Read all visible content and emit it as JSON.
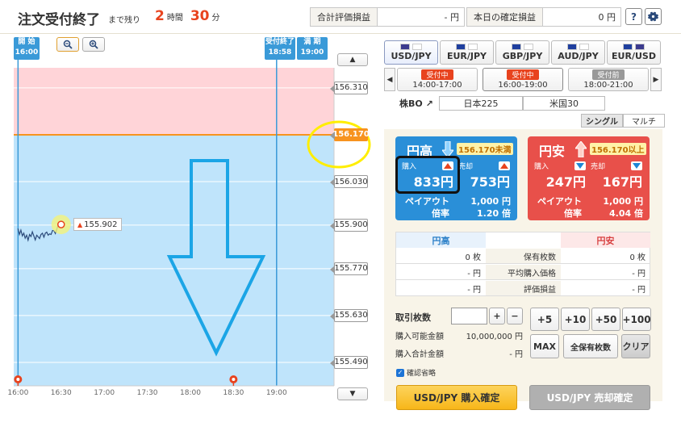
{
  "header": {
    "title": "注文受付終了",
    "remaining_label": "まで残り",
    "hours": "2",
    "hours_unit": "時間",
    "minutes": "30",
    "minutes_unit": "分",
    "total_pl_label": "合計評価損益",
    "total_pl_value": "- 円",
    "today_pl_label": "本日の確定損益",
    "today_pl_value": "0 円",
    "help_label": "?",
    "settings_icon": "gear-icon"
  },
  "chart": {
    "zoom_out_icon": "zoom-out-icon",
    "zoom_in_icon": "zoom-in-icon",
    "start": {
      "label": "開 始",
      "time": "16:00"
    },
    "cutoff": {
      "label": "受付終了",
      "time": "18:58"
    },
    "expiry": {
      "label": "満 期",
      "time": "19:00"
    },
    "price_labels": [
      "156.310",
      "156.170",
      "156.030",
      "155.900",
      "155.770",
      "155.630",
      "155.490"
    ],
    "current_price": "155.902",
    "strike": "156.170",
    "time_labels": [
      "16:00",
      "16:30",
      "17:00",
      "17:30",
      "18:00",
      "18:30",
      "19:00"
    ],
    "colors": {
      "above": "#ffd4d8",
      "below": "#bfe4fb",
      "strike_line": "#f7931e",
      "marker_line": "#3a9ad8",
      "highlight_circle": "#ffee00",
      "big_arrow": "#1ba5e6"
    }
  },
  "chart_data": {
    "type": "line",
    "x": [
      "16:00",
      "16:01",
      "16:02",
      "16:03",
      "16:04",
      "16:05",
      "16:06",
      "16:07",
      "16:08",
      "16:09",
      "16:10",
      "16:11",
      "16:12",
      "16:13",
      "16:14",
      "16:15",
      "16:16",
      "16:17",
      "16:18",
      "16:19",
      "16:20",
      "16:21",
      "16:22",
      "16:23",
      "16:24",
      "16:25",
      "16:26",
      "16:27",
      "16:28",
      "16:29",
      "16:30"
    ],
    "series": [
      {
        "values": [
          155.89,
          155.872,
          155.885,
          155.868,
          155.876,
          155.861,
          155.87,
          155.855,
          155.872,
          155.866,
          155.88,
          155.868,
          155.856,
          155.87,
          155.865,
          155.86,
          155.872,
          155.876,
          155.864,
          155.876,
          155.879,
          155.87,
          155.874,
          155.872,
          155.884,
          155.884,
          155.875,
          155.888,
          155.9,
          155.905,
          155.902
        ]
      }
    ],
    "ylim": [
      155.42,
      156.37
    ],
    "xlim": [
      "15:57",
      "19:40"
    ],
    "yticks": [
      "156.310",
      "156.170",
      "156.030",
      "155.900",
      "155.770",
      "155.630",
      "155.490"
    ],
    "xticks": [
      "16:00",
      "16:30",
      "17:00",
      "17:30",
      "18:00",
      "18:30",
      "19:00"
    ],
    "strike": 156.17,
    "grid": true
  },
  "currencies": [
    {
      "label": "USD/JPY",
      "active": true
    },
    {
      "label": "EUR/JPY",
      "active": false
    },
    {
      "label": "GBP/JPY",
      "active": false
    },
    {
      "label": "AUD/JPY",
      "active": false
    },
    {
      "label": "EUR/USD",
      "active": false
    }
  ],
  "sessions": [
    {
      "status": "受付中",
      "time": "14:00-17:00",
      "color": "#e8431e"
    },
    {
      "status": "受付中",
      "time": "16:00-19:00",
      "color": "#e8431e"
    },
    {
      "status": "受付前",
      "time": "18:00-21:00",
      "color": "#999999"
    }
  ],
  "index": {
    "label": "株BO",
    "items": [
      "日本225",
      "米国30"
    ]
  },
  "mode": {
    "single": "シングル",
    "multi": "マルチ"
  },
  "high": {
    "title": "円高",
    "condition": "156.170未満",
    "buy_label": "購入",
    "buy_price": "833円",
    "sell_label": "売却",
    "sell_price": "753円",
    "payout_label": "ペイアウト",
    "payout": "1,000 円",
    "odds_label": "倍率",
    "odds": "1.20 倍",
    "color": "#2a8fd8"
  },
  "low": {
    "title": "円安",
    "condition": "156.170以上",
    "buy_label": "購入",
    "buy_price": "247円",
    "sell_label": "売却",
    "sell_price": "167円",
    "payout_label": "ペイアウト",
    "payout": "1,000 円",
    "odds_label": "倍率",
    "odds": "4.04 倍",
    "color": "#e8504a"
  },
  "holdings": {
    "col_high": "円高",
    "col_low": "円安",
    "rows": [
      {
        "label": "保有枚数",
        "high": "0 枚",
        "low": "0 枚"
      },
      {
        "label": "平均購入価格",
        "high": "- 円",
        "low": "- 円"
      },
      {
        "label": "評価損益",
        "high": "- 円",
        "low": "- 円"
      }
    ]
  },
  "order": {
    "qty_label": "取引枚数",
    "qty_value": "",
    "plus": "+",
    "minus": "−",
    "available_label": "購入可能金額",
    "available_value": "10,000,000 円",
    "total_label": "購入合計金額",
    "total_value": "- 円",
    "quick": [
      "+5",
      "+10",
      "+50",
      "+100"
    ],
    "max": "MAX",
    "all_hold": "全保有枚数",
    "clear": "クリア",
    "confirm_label": "確認省略",
    "buy_button": "USD/JPY 購入確定",
    "sell_button": "USD/JPY 売却確定"
  }
}
